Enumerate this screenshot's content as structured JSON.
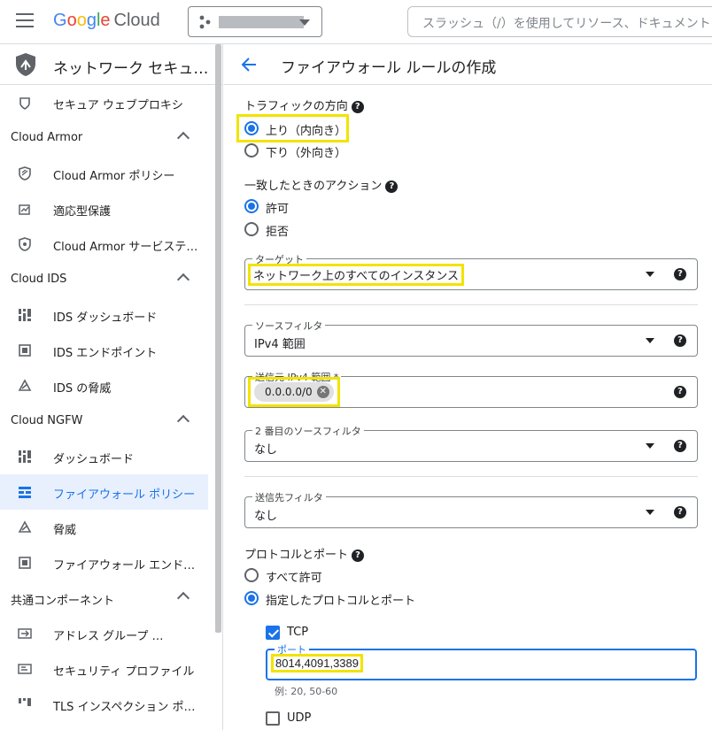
{
  "header": {
    "logo_google": "Google",
    "logo_cloud": "Cloud",
    "search_placeholder": "スラッシュ（/）を使用してリソース、ドキュメント"
  },
  "sidebar": {
    "product_title": "ネットワーク セキュ…",
    "items": [
      {
        "type": "item",
        "label": "セキュア ウェブプロキシ",
        "icon": "secure-web-proxy-icon"
      },
      {
        "type": "section",
        "label": "Cloud Armor"
      },
      {
        "type": "item",
        "label": "Cloud Armor ポリシー",
        "icon": "cloud-armor-policy-icon"
      },
      {
        "type": "item",
        "label": "適応型保護",
        "icon": "adaptive-protection-icon"
      },
      {
        "type": "item",
        "label": "Cloud Armor サービステ…",
        "icon": "shield-icon"
      },
      {
        "type": "section",
        "label": "Cloud IDS"
      },
      {
        "type": "item",
        "label": "IDS ダッシュボード",
        "icon": "dashboard-icon"
      },
      {
        "type": "item",
        "label": "IDS エンドポイント",
        "icon": "endpoint-icon"
      },
      {
        "type": "item",
        "label": "IDS の脅威",
        "icon": "threat-icon"
      },
      {
        "type": "section",
        "label": "Cloud NGFW"
      },
      {
        "type": "item",
        "label": "ダッシュボード",
        "icon": "dashboard-icon"
      },
      {
        "type": "item",
        "label": "ファイアウォール ポリシー",
        "icon": "firewall-icon",
        "active": true
      },
      {
        "type": "item",
        "label": "脅威",
        "icon": "threat-icon"
      },
      {
        "type": "item",
        "label": "ファイアウォール エンド…",
        "icon": "endpoint-icon"
      },
      {
        "type": "section",
        "label": "共通コンポーネント"
      },
      {
        "type": "item",
        "label": "アドレス グループ …",
        "icon": "address-group-icon"
      },
      {
        "type": "item",
        "label": "セキュリティ プロファイル",
        "icon": "security-profile-icon"
      },
      {
        "type": "item",
        "label": "TLS インスペクション ポ…",
        "icon": "tls-icon"
      }
    ]
  },
  "main": {
    "title": "ファイアウォール ルールの作成",
    "traffic": {
      "label": "トラフィックの方向",
      "ingress": "上り（内向き）",
      "egress": "下り（外向き）"
    },
    "action": {
      "label": "一致したときのアクション",
      "allow": "許可",
      "deny": "拒否"
    },
    "target": {
      "label": "ターゲット",
      "value": "ネットワーク上のすべてのインスタンス"
    },
    "source_filter": {
      "label": "ソースフィルタ",
      "value": "IPv4 範囲"
    },
    "source_ipv4": {
      "label": "送信元 IPv4 範囲 *",
      "chip": "0.0.0.0/0"
    },
    "second_source_filter": {
      "label": "2 番目のソースフィルタ",
      "value": "なし"
    },
    "dest_filter": {
      "label": "送信先フィルタ",
      "value": "なし"
    },
    "protocols": {
      "label": "プロトコルとポート",
      "allow_all": "すべて許可",
      "specified": "指定したプロトコルとポート",
      "tcp": "TCP",
      "port_label": "ポート",
      "ports": "8014,4091,3389",
      "example": "例: 20, 50-60",
      "udp": "UDP"
    },
    "help_glyph": "?",
    "chip_remove_glyph": "✕"
  },
  "colors": {
    "accent": "#1a73e8",
    "highlight": "#f2e300",
    "active_bg": "#e8f0fe"
  }
}
